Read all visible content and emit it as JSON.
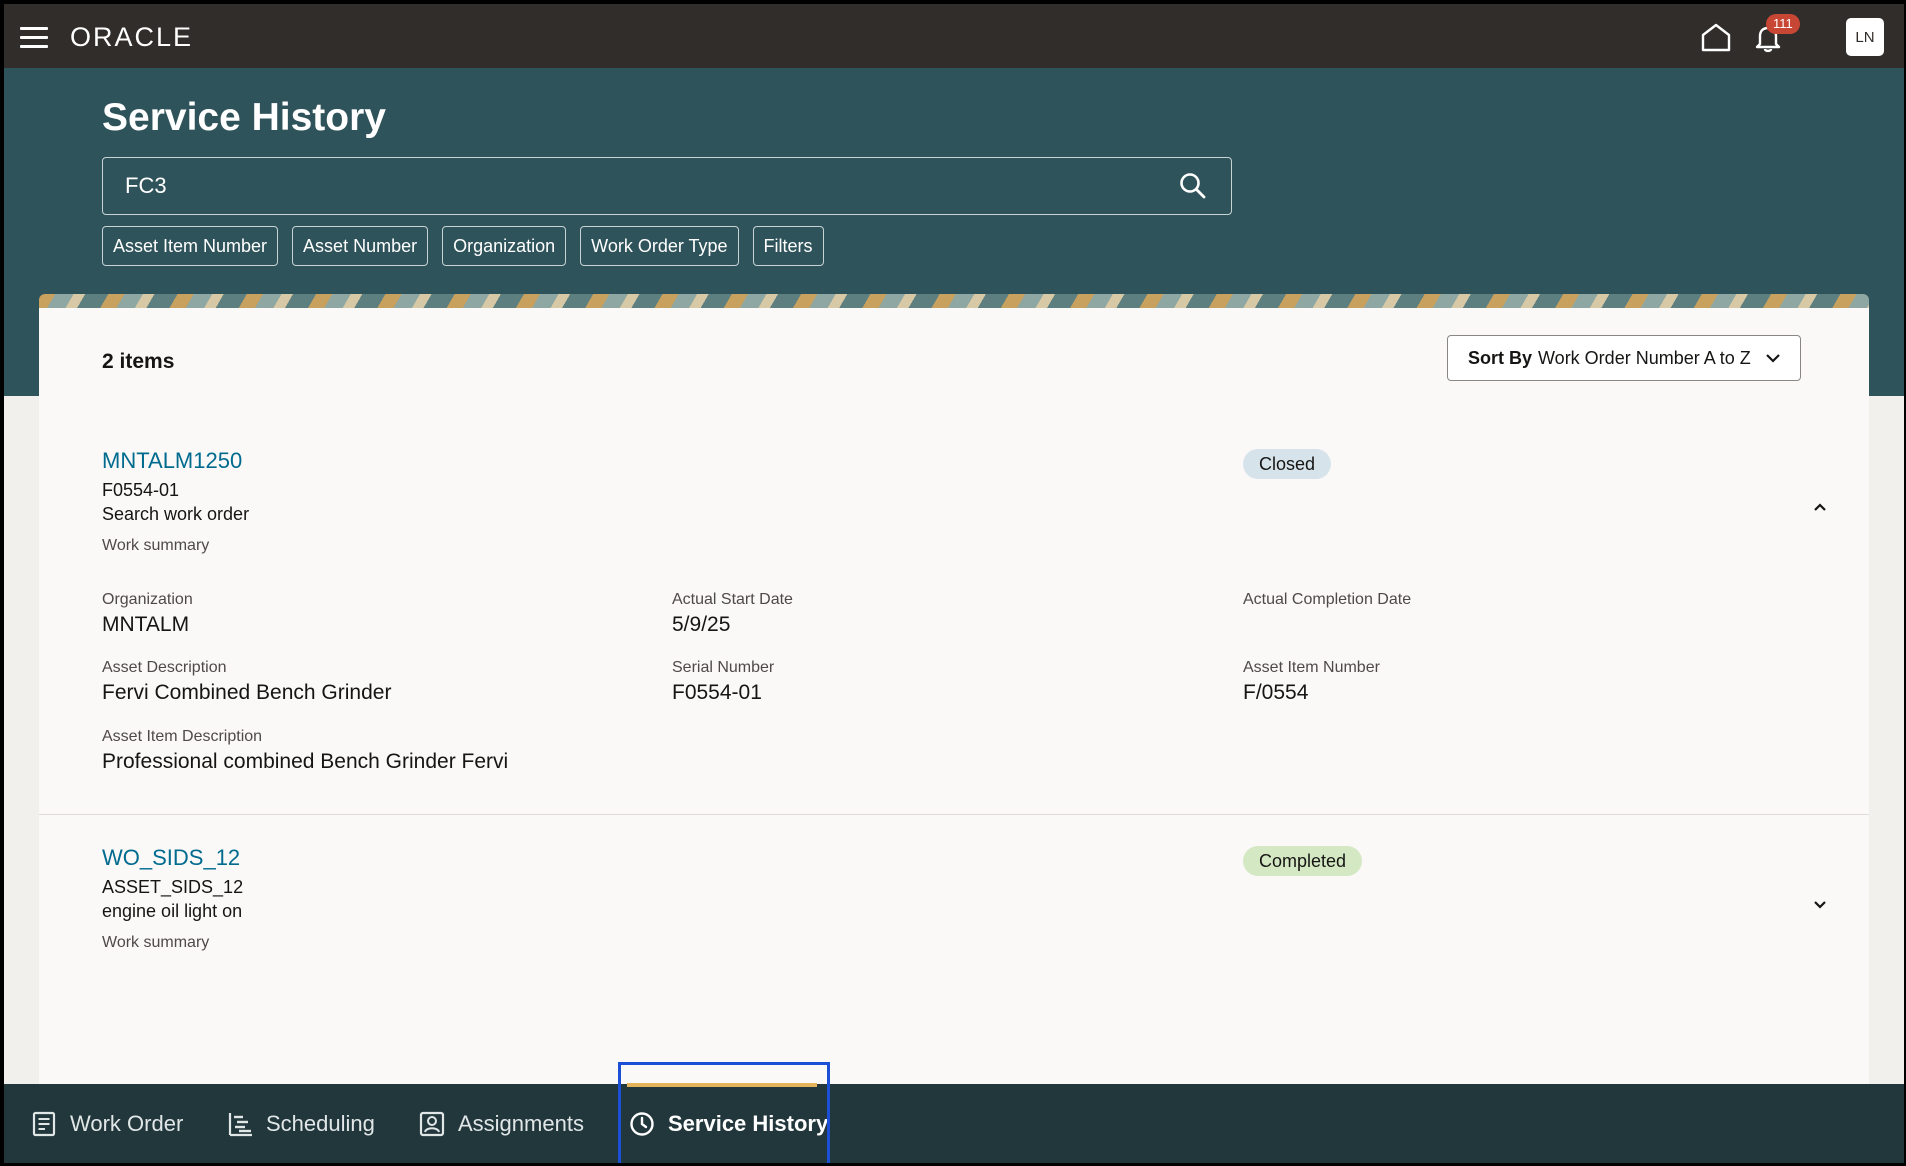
{
  "topbar": {
    "logo": "ORACLE",
    "notification_count": "111",
    "avatar_initials": "LN"
  },
  "header": {
    "title": "Service History",
    "search_value": "FC3",
    "filter_chips": [
      "Asset Item Number",
      "Asset Number",
      "Organization",
      "Work Order Type",
      "Filters"
    ]
  },
  "results": {
    "count_label": "2 items",
    "sort_prefix": "Sort By",
    "sort_value": "Work Order Number A to Z"
  },
  "items": [
    {
      "work_order": "MNTALM1250",
      "asset": "F0554-01",
      "description": "Search work order",
      "summary_label": "Work summary",
      "status": "Closed",
      "fields": {
        "organization_label": "Organization",
        "organization": "MNTALM",
        "actual_start_label": "Actual Start Date",
        "actual_start": "5/9/25",
        "actual_completion_label": "Actual Completion Date",
        "actual_completion": "",
        "asset_description_label": "Asset Description",
        "asset_description": "Fervi Combined Bench Grinder",
        "serial_number_label": "Serial Number",
        "serial_number": "F0554-01",
        "asset_item_number_label": "Asset Item Number",
        "asset_item_number": "F/0554",
        "asset_item_description_label": "Asset Item Description",
        "asset_item_description": "Professional combined Bench Grinder Fervi"
      }
    },
    {
      "work_order": "WO_SIDS_12",
      "asset": "ASSET_SIDS_12",
      "description": "engine oil light on",
      "summary_label": "Work summary",
      "status": "Completed"
    }
  ],
  "bottom_nav": [
    {
      "label": "Work Order",
      "icon": "document-icon"
    },
    {
      "label": "Scheduling",
      "icon": "gantt-icon"
    },
    {
      "label": "Assignments",
      "icon": "person-badge-icon"
    },
    {
      "label": "Service History",
      "icon": "clock-icon"
    }
  ]
}
